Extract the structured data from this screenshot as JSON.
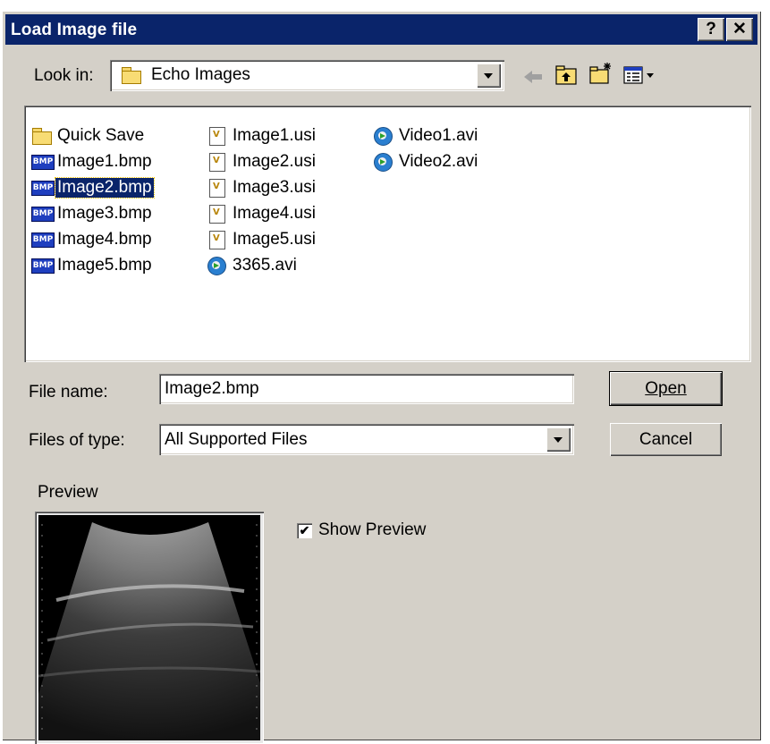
{
  "window": {
    "title": "Load Image file",
    "help_label": "?",
    "close_label": "✕"
  },
  "lookin": {
    "label": "Look in:",
    "value": "Echo Images"
  },
  "files": {
    "col1": [
      {
        "name": "Quick Save",
        "icon": "folder-icon"
      },
      {
        "name": "Image1.bmp",
        "icon": "bmp-file-icon"
      },
      {
        "name": "Image2.bmp",
        "icon": "bmp-file-icon",
        "selected": true
      },
      {
        "name": "Image3.bmp",
        "icon": "bmp-file-icon"
      },
      {
        "name": "Image4.bmp",
        "icon": "bmp-file-icon"
      },
      {
        "name": "Image5.bmp",
        "icon": "bmp-file-icon"
      }
    ],
    "col2": [
      {
        "name": "Image1.usi",
        "icon": "usi-file-icon"
      },
      {
        "name": "Image2.usi",
        "icon": "usi-file-icon"
      },
      {
        "name": "Image3.usi",
        "icon": "usi-file-icon"
      },
      {
        "name": "Image4.usi",
        "icon": "usi-file-icon"
      },
      {
        "name": "Image5.usi",
        "icon": "usi-file-icon"
      },
      {
        "name": "3365.avi",
        "icon": "avi-file-icon"
      }
    ],
    "col3": [
      {
        "name": "Video1.avi",
        "icon": "avi-file-icon"
      },
      {
        "name": "Video2.avi",
        "icon": "avi-file-icon"
      }
    ],
    "bmp_badge": "BMP"
  },
  "filename": {
    "label": "File name:",
    "value": "Image2.bmp"
  },
  "filetype": {
    "label": "Files of type:",
    "value": "All Supported Files"
  },
  "buttons": {
    "open": "Open",
    "cancel": "Cancel"
  },
  "preview": {
    "label": "Preview",
    "show_label": "Show Preview",
    "checked": true,
    "checkmark": "✔"
  },
  "colors": {
    "titlebar": "#0a246a",
    "face": "#d4d0c8",
    "selection": "#0a246a"
  }
}
